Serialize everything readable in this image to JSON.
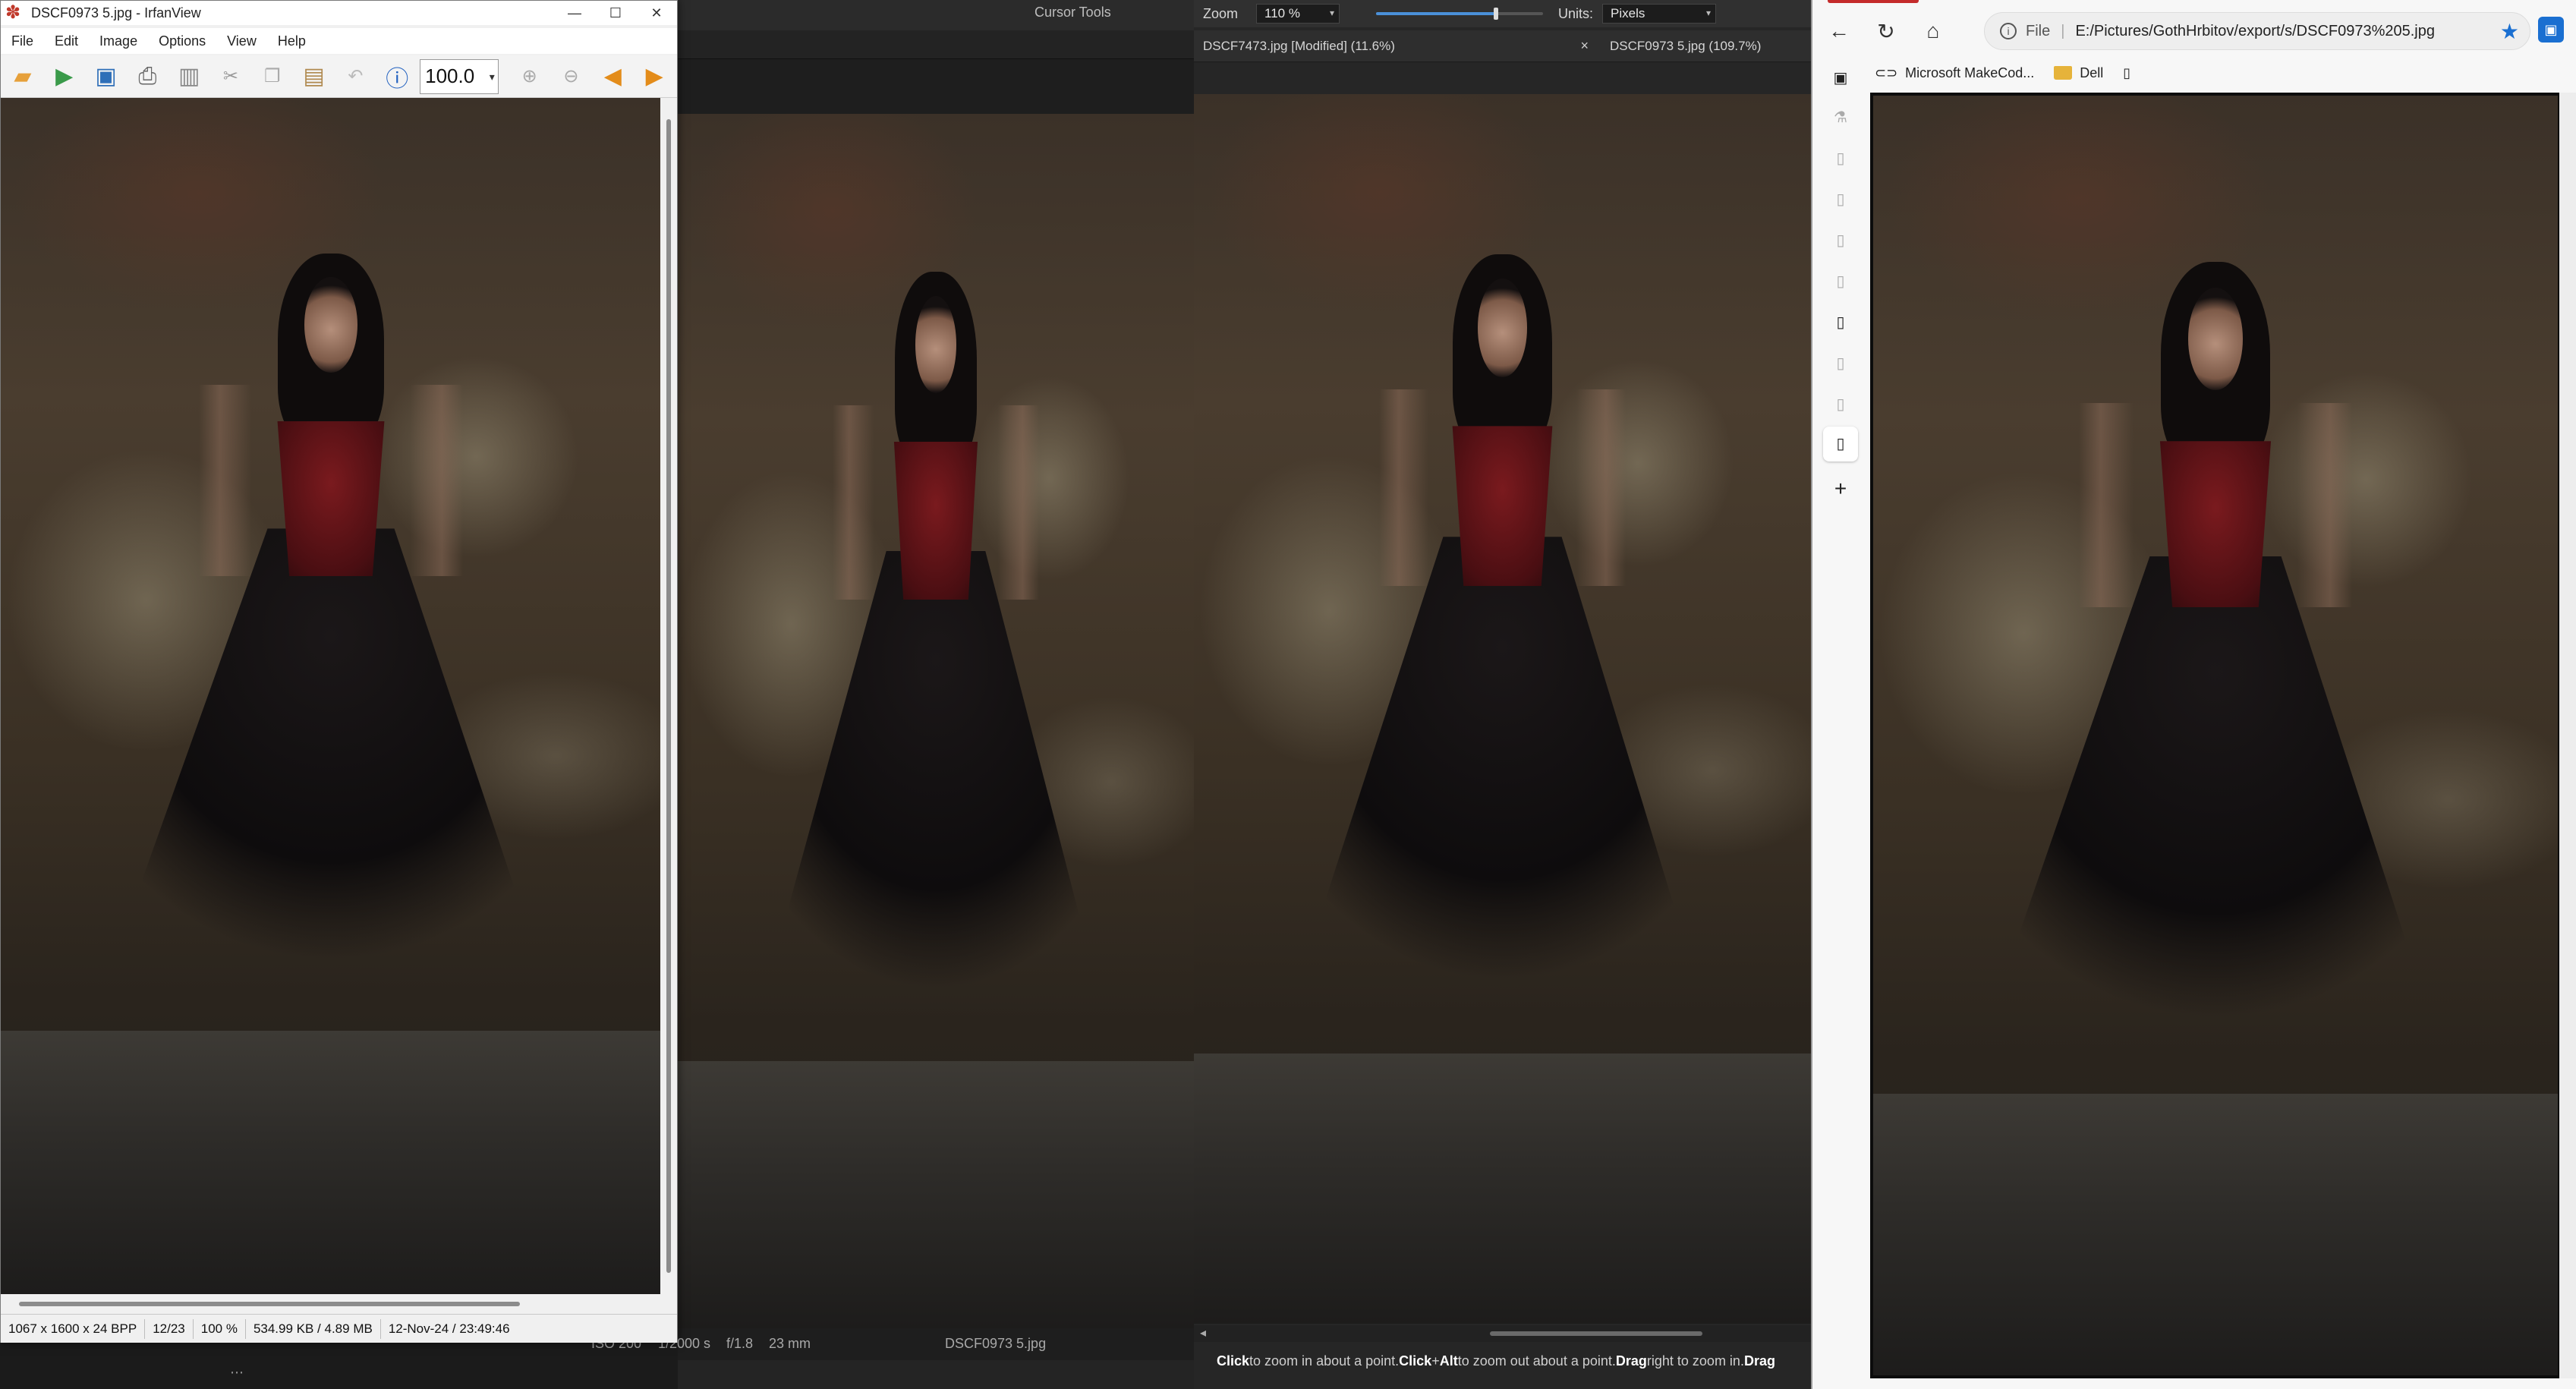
{
  "irfanview": {
    "title": "DSCF0973 5.jpg - IrfanView",
    "window_buttons": [
      "—",
      "☐",
      "✕"
    ],
    "menu": [
      "File",
      "Edit",
      "Image",
      "Options",
      "View",
      "Help"
    ],
    "toolbar": {
      "zoom_value": "100.0",
      "icons": [
        "open-folder-icon",
        "slideshow-icon",
        "save-icon",
        "print-icon",
        "delete-icon",
        "cut-icon",
        "copy-icon",
        "paste-icon",
        "undo-icon",
        "info-icon",
        "zoom-in-icon",
        "zoom-out-icon",
        "previous-icon",
        "next-icon"
      ]
    },
    "status": [
      "1067 x 1600 x 24 BPP",
      "12/23",
      "100 %",
      "534.99 KB / 4.89 MB",
      "12-Nov-24 / 23:49:46"
    ]
  },
  "lightroom": {
    "cursor_tools": "Cursor Tools",
    "info": {
      "iso": "ISO 200",
      "shutter": "1/2000 s",
      "aperture": "f/1.8",
      "focal": "23 mm",
      "filename": "DSCF0973 5.jpg"
    }
  },
  "affinity": {
    "zoom_label": "Zoom",
    "zoom_value": "110 %",
    "units_label": "Units:",
    "units_value": "Pixels",
    "zoom_slider_level": 0.72,
    "tabs": [
      {
        "label": "DSCF7473.jpg [Modified] (11.6%)",
        "close": "×"
      },
      {
        "label": "DSCF0973 5.jpg (109.7%)"
      }
    ],
    "hint": {
      "click": "Click",
      "t1": " to zoom in about a point. ",
      "click2": "Click",
      "plus": "+",
      "alt": "Alt",
      "t2": " to zoom out about a point. ",
      "drag": "Drag",
      "t3": " right to zoom in. ",
      "drag2": "Drag"
    }
  },
  "browser": {
    "address_scheme": "File",
    "address_url": "E:/Pictures/GothHrbitov/export/s/DSCF0973%205.jpg",
    "bookmarks": [
      "Microsoft MakeCod...",
      "Dell"
    ],
    "colors": {
      "accent": "#c42b2b",
      "star": "#1a6fd1"
    }
  }
}
